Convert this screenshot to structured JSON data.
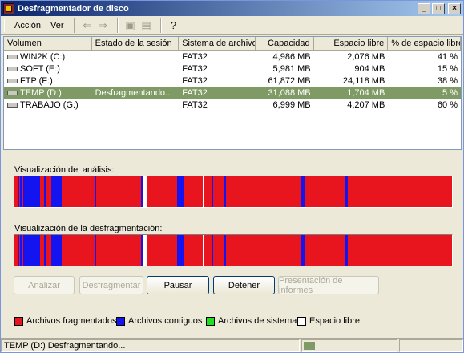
{
  "window": {
    "title": "Desfragmentador de disco"
  },
  "titlebar_buttons": {
    "minimize": "_",
    "maximize": "□",
    "close": "×"
  },
  "menu": [
    {
      "label": "Acción",
      "key": "A"
    },
    {
      "label": "Ver",
      "key": "V"
    }
  ],
  "toolbar": [
    {
      "icon": "back-arrow-icon",
      "glyph": "⇐",
      "enabled": false
    },
    {
      "icon": "forward-arrow-icon",
      "glyph": "⇒",
      "enabled": false
    },
    {
      "icon": "folder-up-icon",
      "glyph": "▣",
      "enabled": false
    },
    {
      "icon": "show-hide-tree-icon",
      "glyph": "▤",
      "enabled": false
    },
    {
      "icon": "help-icon",
      "glyph": "?",
      "enabled": true
    }
  ],
  "columns": [
    "Volumen",
    "Estado de la sesión",
    "Sistema de archivos",
    "Capacidad",
    "Espacio libre",
    "% de espacio libre"
  ],
  "volumes": [
    {
      "name": "WIN2K (C:)",
      "state": "",
      "fs": "FAT32",
      "capacity": "4,986 MB",
      "free": "2,076 MB",
      "pct": "41 %",
      "selected": false
    },
    {
      "name": "SOFT (E:)",
      "state": "",
      "fs": "FAT32",
      "capacity": "5,981 MB",
      "free": "904 MB",
      "pct": "15 %",
      "selected": false
    },
    {
      "name": "FTP (F:)",
      "state": "",
      "fs": "FAT32",
      "capacity": "61,872 MB",
      "free": "24,118 MB",
      "pct": "38 %",
      "selected": false
    },
    {
      "name": "TEMP (D:)",
      "state": "Desfragmentando...",
      "fs": "FAT32",
      "capacity": "31,088 MB",
      "free": "1,704 MB",
      "pct": "5 %",
      "selected": true
    },
    {
      "name": "TRABAJO (G:)",
      "state": "",
      "fs": "FAT32",
      "capacity": "6,999 MB",
      "free": "4,207 MB",
      "pct": "60 %",
      "selected": false
    }
  ],
  "analysis": {
    "label": "Visualización del análisis:"
  },
  "defrag": {
    "label": "Visualización de la desfragmentación:"
  },
  "buttons": [
    {
      "label": "Analizar",
      "enabled": false
    },
    {
      "label": "Desfragmentar",
      "enabled": false
    },
    {
      "label": "Pausar",
      "enabled": true
    },
    {
      "label": "Detener",
      "enabled": true
    },
    {
      "label": "Presentación de informes",
      "enabled": false
    }
  ],
  "legend": [
    {
      "label": "Archivos fragmentados",
      "color": "#e8141e"
    },
    {
      "label": "Archivos contiguos",
      "color": "#1414f0"
    },
    {
      "label": "Archivos de sistema",
      "color": "#1ee11e"
    },
    {
      "label": "Espacio libre",
      "color": "#ffffff"
    }
  ],
  "status": {
    "text": "TEMP (D:) Desfragmentando...",
    "progress": 0.12
  },
  "colors": {
    "fragmented": "#e8141e",
    "contiguous": "#1414f0",
    "system": "#1ee11e",
    "free": "#ffffff",
    "selection": "#7f9a64"
  }
}
